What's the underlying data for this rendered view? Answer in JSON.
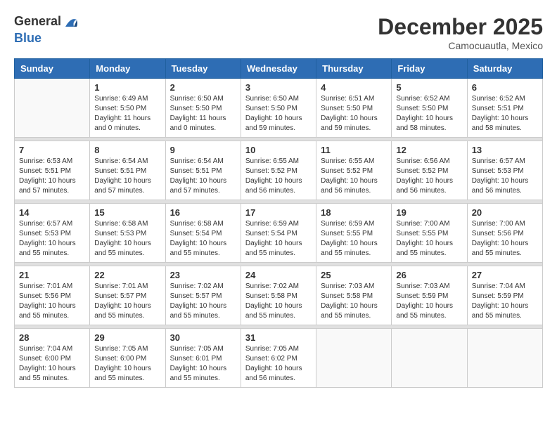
{
  "header": {
    "logo": {
      "general": "General",
      "blue": "Blue"
    },
    "title": "December 2025",
    "location": "Camocuautla, Mexico"
  },
  "calendar": {
    "weekdays": [
      "Sunday",
      "Monday",
      "Tuesday",
      "Wednesday",
      "Thursday",
      "Friday",
      "Saturday"
    ],
    "weeks": [
      [
        {
          "day": "",
          "info": ""
        },
        {
          "day": "1",
          "info": "Sunrise: 6:49 AM\nSunset: 5:50 PM\nDaylight: 11 hours\nand 0 minutes."
        },
        {
          "day": "2",
          "info": "Sunrise: 6:50 AM\nSunset: 5:50 PM\nDaylight: 11 hours\nand 0 minutes."
        },
        {
          "day": "3",
          "info": "Sunrise: 6:50 AM\nSunset: 5:50 PM\nDaylight: 10 hours\nand 59 minutes."
        },
        {
          "day": "4",
          "info": "Sunrise: 6:51 AM\nSunset: 5:50 PM\nDaylight: 10 hours\nand 59 minutes."
        },
        {
          "day": "5",
          "info": "Sunrise: 6:52 AM\nSunset: 5:50 PM\nDaylight: 10 hours\nand 58 minutes."
        },
        {
          "day": "6",
          "info": "Sunrise: 6:52 AM\nSunset: 5:51 PM\nDaylight: 10 hours\nand 58 minutes."
        }
      ],
      [
        {
          "day": "7",
          "info": "Sunrise: 6:53 AM\nSunset: 5:51 PM\nDaylight: 10 hours\nand 57 minutes."
        },
        {
          "day": "8",
          "info": "Sunrise: 6:54 AM\nSunset: 5:51 PM\nDaylight: 10 hours\nand 57 minutes."
        },
        {
          "day": "9",
          "info": "Sunrise: 6:54 AM\nSunset: 5:51 PM\nDaylight: 10 hours\nand 57 minutes."
        },
        {
          "day": "10",
          "info": "Sunrise: 6:55 AM\nSunset: 5:52 PM\nDaylight: 10 hours\nand 56 minutes."
        },
        {
          "day": "11",
          "info": "Sunrise: 6:55 AM\nSunset: 5:52 PM\nDaylight: 10 hours\nand 56 minutes."
        },
        {
          "day": "12",
          "info": "Sunrise: 6:56 AM\nSunset: 5:52 PM\nDaylight: 10 hours\nand 56 minutes."
        },
        {
          "day": "13",
          "info": "Sunrise: 6:57 AM\nSunset: 5:53 PM\nDaylight: 10 hours\nand 56 minutes."
        }
      ],
      [
        {
          "day": "14",
          "info": "Sunrise: 6:57 AM\nSunset: 5:53 PM\nDaylight: 10 hours\nand 55 minutes."
        },
        {
          "day": "15",
          "info": "Sunrise: 6:58 AM\nSunset: 5:53 PM\nDaylight: 10 hours\nand 55 minutes."
        },
        {
          "day": "16",
          "info": "Sunrise: 6:58 AM\nSunset: 5:54 PM\nDaylight: 10 hours\nand 55 minutes."
        },
        {
          "day": "17",
          "info": "Sunrise: 6:59 AM\nSunset: 5:54 PM\nDaylight: 10 hours\nand 55 minutes."
        },
        {
          "day": "18",
          "info": "Sunrise: 6:59 AM\nSunset: 5:55 PM\nDaylight: 10 hours\nand 55 minutes."
        },
        {
          "day": "19",
          "info": "Sunrise: 7:00 AM\nSunset: 5:55 PM\nDaylight: 10 hours\nand 55 minutes."
        },
        {
          "day": "20",
          "info": "Sunrise: 7:00 AM\nSunset: 5:56 PM\nDaylight: 10 hours\nand 55 minutes."
        }
      ],
      [
        {
          "day": "21",
          "info": "Sunrise: 7:01 AM\nSunset: 5:56 PM\nDaylight: 10 hours\nand 55 minutes."
        },
        {
          "day": "22",
          "info": "Sunrise: 7:01 AM\nSunset: 5:57 PM\nDaylight: 10 hours\nand 55 minutes."
        },
        {
          "day": "23",
          "info": "Sunrise: 7:02 AM\nSunset: 5:57 PM\nDaylight: 10 hours\nand 55 minutes."
        },
        {
          "day": "24",
          "info": "Sunrise: 7:02 AM\nSunset: 5:58 PM\nDaylight: 10 hours\nand 55 minutes."
        },
        {
          "day": "25",
          "info": "Sunrise: 7:03 AM\nSunset: 5:58 PM\nDaylight: 10 hours\nand 55 minutes."
        },
        {
          "day": "26",
          "info": "Sunrise: 7:03 AM\nSunset: 5:59 PM\nDaylight: 10 hours\nand 55 minutes."
        },
        {
          "day": "27",
          "info": "Sunrise: 7:04 AM\nSunset: 5:59 PM\nDaylight: 10 hours\nand 55 minutes."
        }
      ],
      [
        {
          "day": "28",
          "info": "Sunrise: 7:04 AM\nSunset: 6:00 PM\nDaylight: 10 hours\nand 55 minutes."
        },
        {
          "day": "29",
          "info": "Sunrise: 7:05 AM\nSunset: 6:00 PM\nDaylight: 10 hours\nand 55 minutes."
        },
        {
          "day": "30",
          "info": "Sunrise: 7:05 AM\nSunset: 6:01 PM\nDaylight: 10 hours\nand 55 minutes."
        },
        {
          "day": "31",
          "info": "Sunrise: 7:05 AM\nSunset: 6:02 PM\nDaylight: 10 hours\nand 56 minutes."
        },
        {
          "day": "",
          "info": ""
        },
        {
          "day": "",
          "info": ""
        },
        {
          "day": "",
          "info": ""
        }
      ]
    ]
  }
}
